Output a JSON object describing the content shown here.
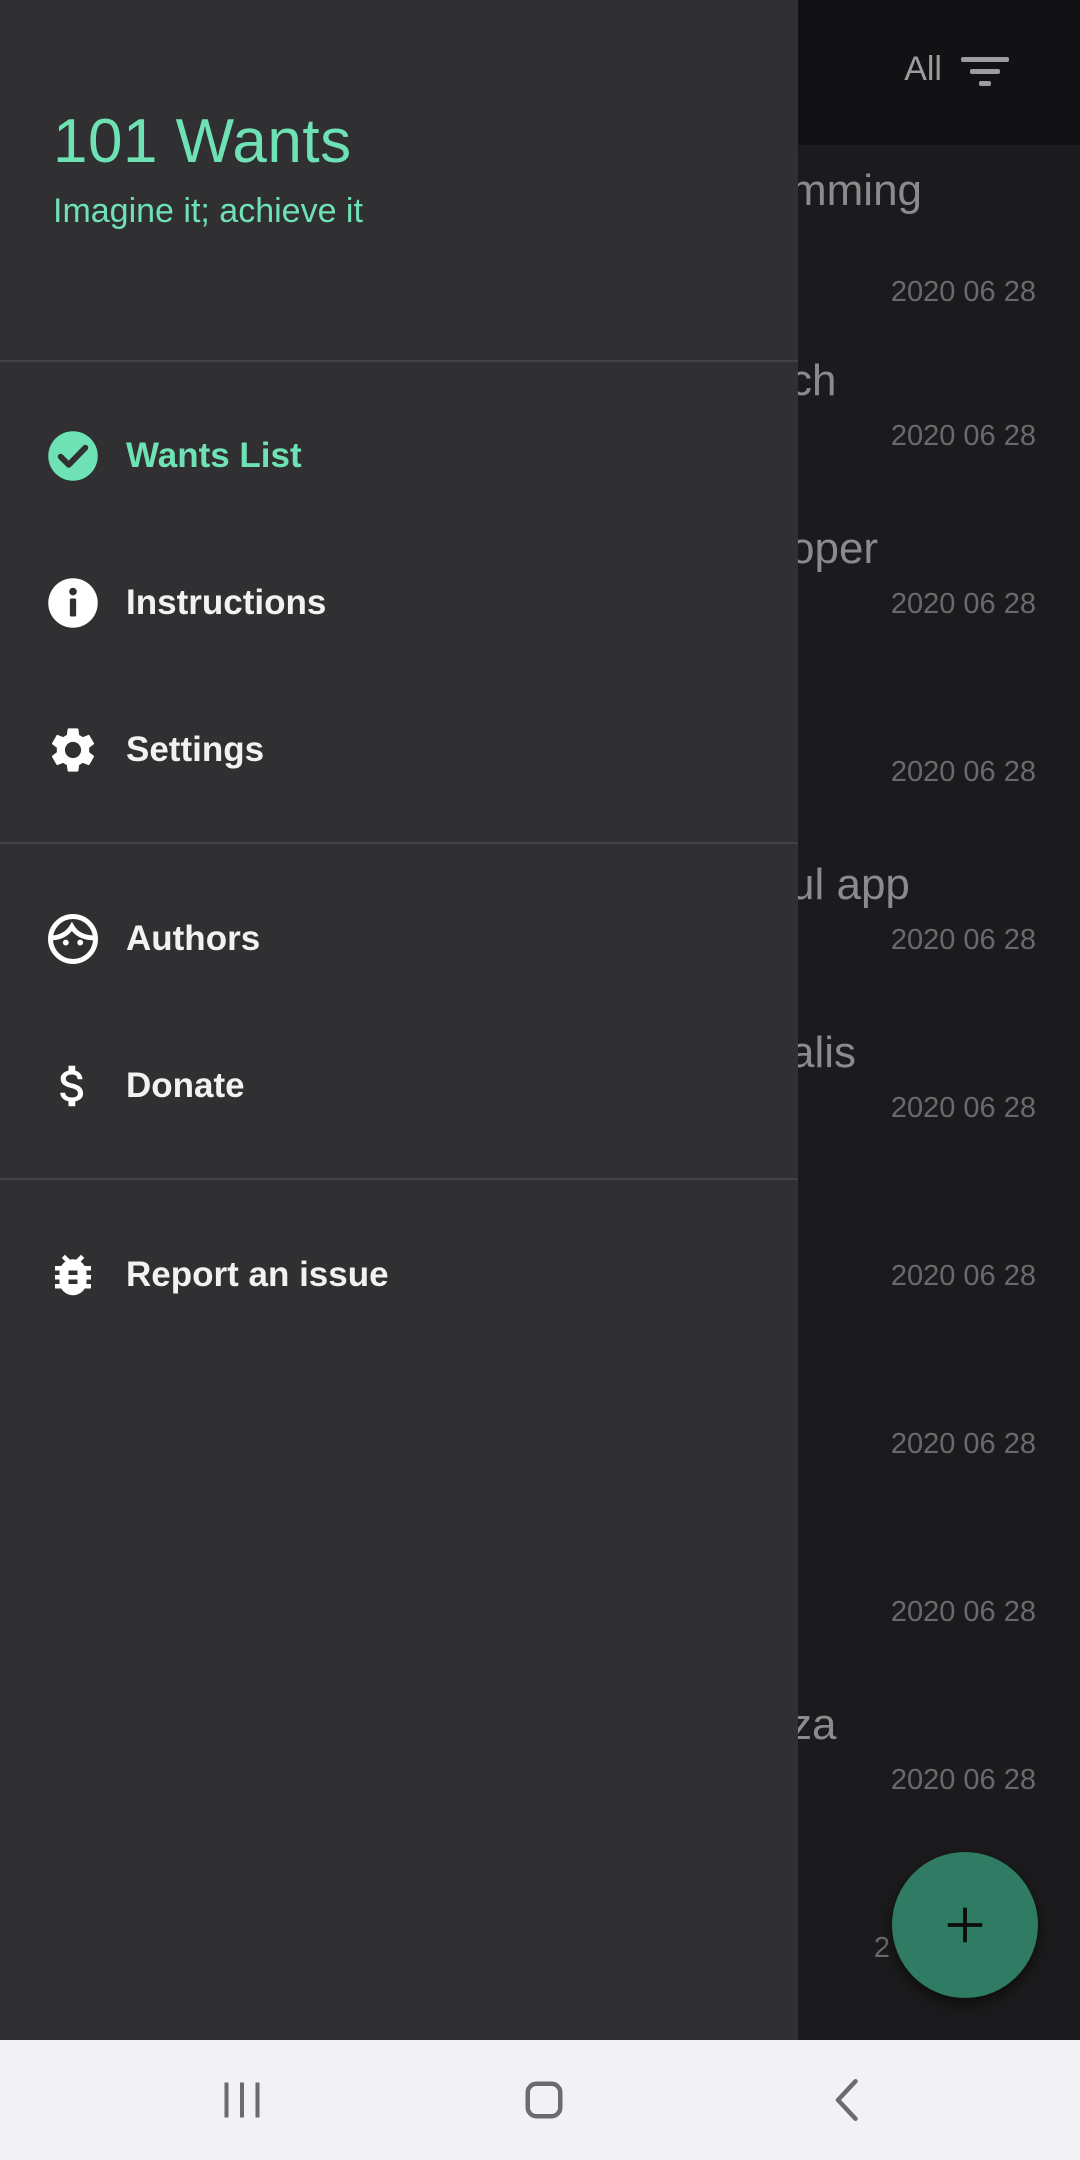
{
  "app": {
    "filter_label": "All",
    "wants": [
      {
        "title": "mming",
        "date": "2020 06 28"
      },
      {
        "title": "ch",
        "date": "2020 06 28"
      },
      {
        "title": "oper",
        "date": "2020 06 28"
      },
      {
        "title": "",
        "date": "2020 06 28"
      },
      {
        "title": "ul app",
        "date": "2020 06 28"
      },
      {
        "title": "alis",
        "date": "2020 06 28"
      },
      {
        "title": "",
        "date": "2020 06 28"
      },
      {
        "title": "",
        "date": "2020 06 28"
      },
      {
        "title": "",
        "date": "2020 06 28"
      },
      {
        "title": "za",
        "date": "2020 06 28"
      },
      {
        "title": "",
        "date": "2"
      }
    ]
  },
  "drawer": {
    "app_name": "101 Wants",
    "tagline": "Imagine it; achieve it",
    "menu": [
      {
        "label": "Wants List",
        "icon": "check-circle-icon",
        "active": true
      },
      {
        "label": "Instructions",
        "icon": "info-icon",
        "active": false
      },
      {
        "label": "Settings",
        "icon": "gear-icon",
        "active": false
      },
      {
        "label": "Authors",
        "icon": "face-icon",
        "active": false
      },
      {
        "label": "Donate",
        "icon": "dollar-icon",
        "active": false
      },
      {
        "label": "Report an issue",
        "icon": "bug-icon",
        "active": false
      }
    ]
  },
  "colors": {
    "accent": "#6ee2b4",
    "drawer_bg": "#302f32",
    "fab": "#2f7b63"
  }
}
